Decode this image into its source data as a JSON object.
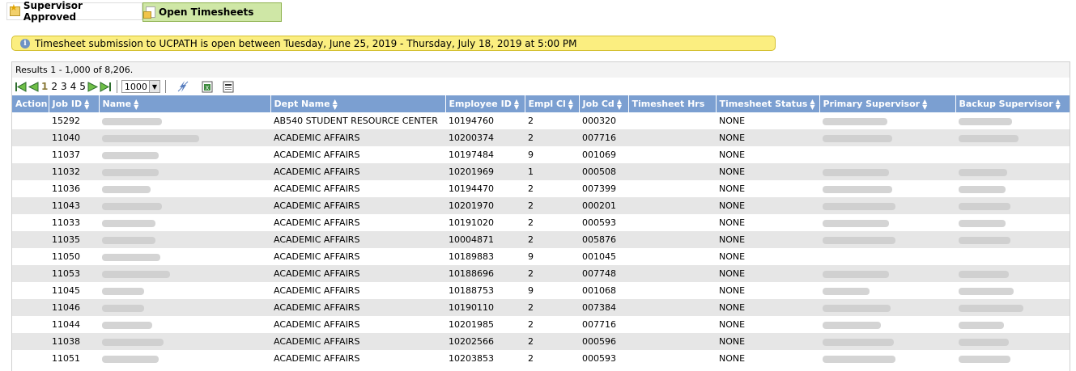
{
  "tabs": [
    {
      "label": "Supervisor Approved",
      "icon": "star-folder-icon",
      "active": false
    },
    {
      "label": "Open Timesheets",
      "icon": "document-folder-icon",
      "active": true
    }
  ],
  "banner": {
    "icon": "info-icon",
    "text": "Timesheet submission to UCPATH is open between Tuesday, June 25, 2019 - Thursday, July 18, 2019 at 5:00 PM"
  },
  "results": {
    "text": "Results 1 - 1,000 of 8,206."
  },
  "pager": {
    "pages": [
      "1",
      "2",
      "3",
      "4",
      "5"
    ],
    "current": "1",
    "page_size": "1000"
  },
  "columns": [
    "Action",
    "Job ID",
    "Name",
    "Dept Name",
    "Employee ID",
    "Empl Cl",
    "Job Cd",
    "Timesheet Hrs",
    "Timesheet Status",
    "Primary Supervisor",
    "Backup Supervisor"
  ],
  "rows": [
    {
      "job_id": "15292",
      "dept": "AB540 STUDENT RESOURCE CENTER",
      "emp_id": "10194760",
      "empl_cl": "2",
      "job_cd": "000320",
      "status": "NONE",
      "has_primary": true,
      "has_backup": true
    },
    {
      "job_id": "11040",
      "dept": "ACADEMIC AFFAIRS",
      "emp_id": "10200374",
      "empl_cl": "2",
      "job_cd": "007716",
      "status": "NONE",
      "has_primary": true,
      "has_backup": true
    },
    {
      "job_id": "11037",
      "dept": "ACADEMIC AFFAIRS",
      "emp_id": "10197484",
      "empl_cl": "9",
      "job_cd": "001069",
      "status": "NONE",
      "has_primary": false,
      "has_backup": false
    },
    {
      "job_id": "11032",
      "dept": "ACADEMIC AFFAIRS",
      "emp_id": "10201969",
      "empl_cl": "1",
      "job_cd": "000508",
      "status": "NONE",
      "has_primary": true,
      "has_backup": true
    },
    {
      "job_id": "11036",
      "dept": "ACADEMIC AFFAIRS",
      "emp_id": "10194470",
      "empl_cl": "2",
      "job_cd": "007399",
      "status": "NONE",
      "has_primary": true,
      "has_backup": true
    },
    {
      "job_id": "11043",
      "dept": "ACADEMIC AFFAIRS",
      "emp_id": "10201970",
      "empl_cl": "2",
      "job_cd": "000201",
      "status": "NONE",
      "has_primary": true,
      "has_backup": true
    },
    {
      "job_id": "11033",
      "dept": "ACADEMIC AFFAIRS",
      "emp_id": "10191020",
      "empl_cl": "2",
      "job_cd": "000593",
      "status": "NONE",
      "has_primary": true,
      "has_backup": true
    },
    {
      "job_id": "11035",
      "dept": "ACADEMIC AFFAIRS",
      "emp_id": "10004871",
      "empl_cl": "2",
      "job_cd": "005876",
      "status": "NONE",
      "has_primary": true,
      "has_backup": true
    },
    {
      "job_id": "11050",
      "dept": "ACADEMIC AFFAIRS",
      "emp_id": "10189883",
      "empl_cl": "9",
      "job_cd": "001045",
      "status": "NONE",
      "has_primary": false,
      "has_backup": false
    },
    {
      "job_id": "11053",
      "dept": "ACADEMIC AFFAIRS",
      "emp_id": "10188696",
      "empl_cl": "2",
      "job_cd": "007748",
      "status": "NONE",
      "has_primary": true,
      "has_backup": true
    },
    {
      "job_id": "11045",
      "dept": "ACADEMIC AFFAIRS",
      "emp_id": "10188753",
      "empl_cl": "9",
      "job_cd": "001068",
      "status": "NONE",
      "has_primary": true,
      "has_backup": true
    },
    {
      "job_id": "11046",
      "dept": "ACADEMIC AFFAIRS",
      "emp_id": "10190110",
      "empl_cl": "2",
      "job_cd": "007384",
      "status": "NONE",
      "has_primary": true,
      "has_backup": true
    },
    {
      "job_id": "11044",
      "dept": "ACADEMIC AFFAIRS",
      "emp_id": "10201985",
      "empl_cl": "2",
      "job_cd": "007716",
      "status": "NONE",
      "has_primary": true,
      "has_backup": true
    },
    {
      "job_id": "11038",
      "dept": "ACADEMIC AFFAIRS",
      "emp_id": "10202566",
      "empl_cl": "2",
      "job_cd": "000596",
      "status": "NONE",
      "has_primary": true,
      "has_backup": true
    },
    {
      "job_id": "11051",
      "dept": "ACADEMIC AFFAIRS",
      "emp_id": "10203853",
      "empl_cl": "2",
      "job_cd": "000593",
      "status": "NONE",
      "has_primary": true,
      "has_backup": true
    }
  ]
}
